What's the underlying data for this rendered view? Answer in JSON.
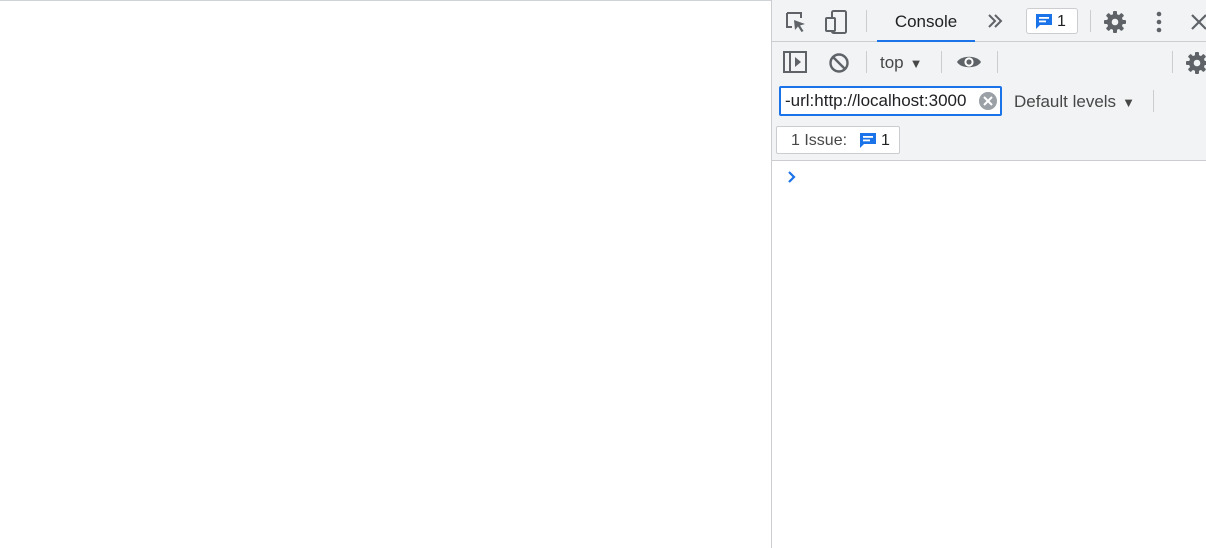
{
  "devtools": {
    "tabs": {
      "console_label": "Console"
    },
    "issues_badge": {
      "count": "1"
    },
    "toolbar": {
      "context": "top"
    },
    "filter": {
      "value": "-url:http://localhost:3000"
    },
    "levels": {
      "label": "Default levels"
    },
    "issues_bar": {
      "label": "1 Issue:",
      "count": "1"
    }
  },
  "colors": {
    "accent": "#1a73e8",
    "toolbar_bg": "#f1f3f4",
    "icon": "#5f6368"
  },
  "icons": [
    "inspect-element-icon",
    "device-toolbar-icon",
    "more-tabs-icon",
    "issue-message-icon",
    "settings-gear-icon",
    "kebab-menu-icon",
    "close-icon",
    "sidebar-toggle-icon",
    "clear-console-icon",
    "live-expression-eye-icon",
    "console-settings-gear-icon",
    "clear-filter-icon",
    "console-prompt-chevron-icon"
  ]
}
